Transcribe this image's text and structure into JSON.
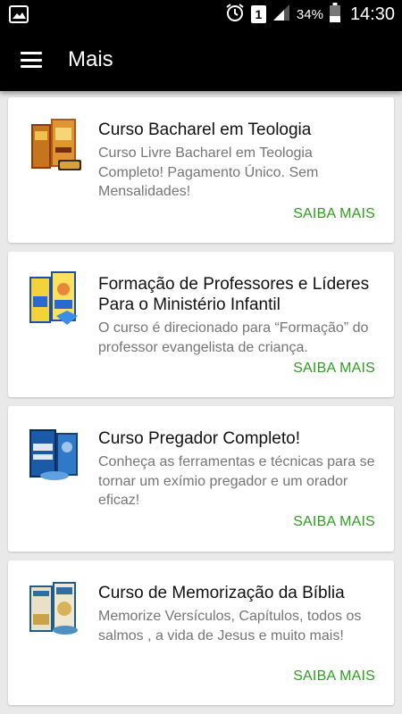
{
  "status_bar": {
    "battery": "34%",
    "time": "14:30",
    "sim": "1",
    "icons": [
      "image-icon",
      "alarm-icon",
      "sim-icon",
      "signal-icon",
      "battery-icon"
    ]
  },
  "app_bar": {
    "title": "Mais",
    "menu_icon": "menu-icon"
  },
  "colors": {
    "app_bar": "#000000",
    "background": "#e9e9e9",
    "accent": "#2e9e1f"
  },
  "cards": [
    {
      "title": "Curso Bacharel em Teologia",
      "description": "Curso Livre Bacharel em Teologia Completo! Pagamento Único. Sem Mensalidades!",
      "cta": "SAIBA MAIS"
    },
    {
      "title": "Formação de Professores e Líderes Para o Ministério Infantil",
      "description": "O curso é direcionado para “Formação” do professor evangelista de criança.",
      "cta": "SAIBA MAIS"
    },
    {
      "title": "Curso Pregador Completo!",
      "description": "Conheça as ferramentas e técnicas para se tornar um exímio pregador e um orador eficaz!",
      "cta": "SAIBA MAIS"
    },
    {
      "title": "Curso de Memorização da Bíblia",
      "description": "Memorize Versículos, Capítulos, todos os salmos , a vida de Jesus e muito mais!",
      "cta": "SAIBA MAIS"
    }
  ]
}
